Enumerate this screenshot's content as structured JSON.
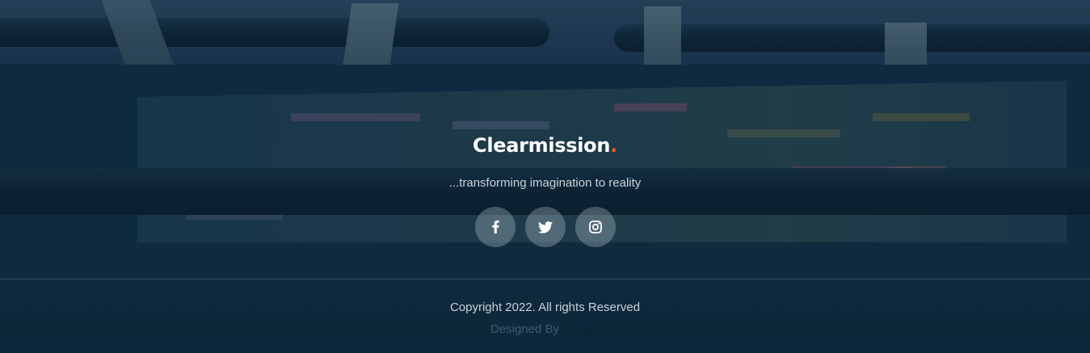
{
  "footer": {
    "brand": {
      "name": "Clearmission",
      "dot": ".",
      "dot_color": "#f0541e"
    },
    "tagline": "...transforming imagination to reality",
    "socials": [
      {
        "icon": "facebook-icon"
      },
      {
        "icon": "twitter-icon"
      },
      {
        "icon": "instagram-icon"
      }
    ],
    "copyright": "Copyright 2022. All rights Reserved",
    "designed_by_label": "Designed By",
    "designer_link": "Sultani"
  },
  "colors": {
    "overlay": "#0d2a41",
    "accent": "#f0541e",
    "text_light": "#c9d2d9"
  }
}
